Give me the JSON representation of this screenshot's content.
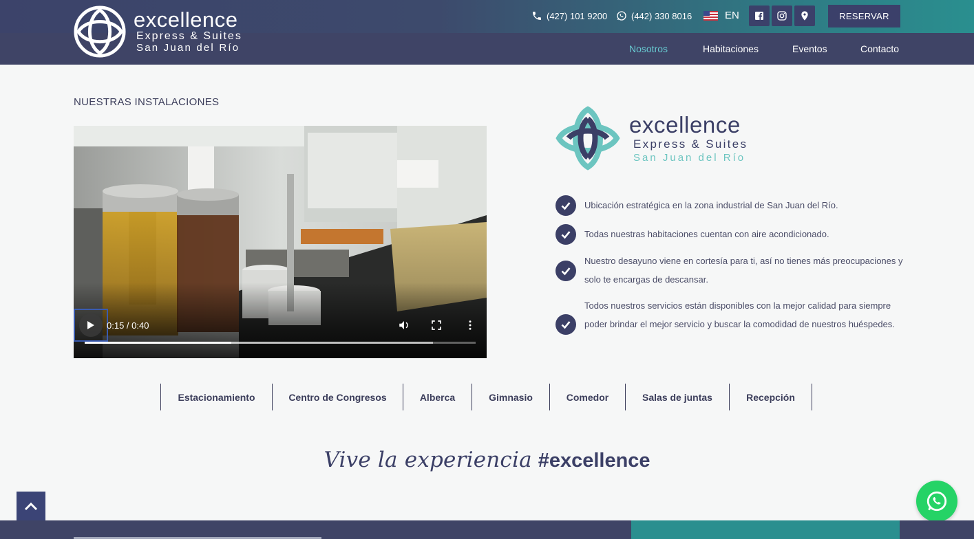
{
  "header": {
    "brand": {
      "word": "excellence",
      "sub1": "Express & Suites",
      "sub2": "San Juan del Río"
    },
    "phone1": {
      "icon": "phone-icon",
      "text": "(427) 101 9200"
    },
    "phone2": {
      "icon": "whatsapp-icon",
      "text": "(442) 330 8016"
    },
    "language": {
      "flag": "us-flag-icon",
      "label": "EN"
    },
    "social": [
      "facebook-icon",
      "instagram-icon",
      "location-pin-icon"
    ],
    "reserve_label": "RESERVAR",
    "nav": [
      {
        "label": "Nosotros",
        "active": true
      },
      {
        "label": "Habitaciones",
        "active": false
      },
      {
        "label": "Eventos",
        "active": false
      },
      {
        "label": "Contacto",
        "active": false
      }
    ]
  },
  "main": {
    "section_title": "NUESTRAS INSTALACIONES",
    "video": {
      "time": "0:15 / 0:40",
      "played": 0.375,
      "buffered": 0.89
    },
    "brand": {
      "word": "excellence",
      "sub1": "Express & Suites",
      "sub2": "San Juan del Río"
    },
    "features": [
      "Ubicación estratégica en la zona industrial de San Juan del Río.",
      "Todas nuestras habitaciones cuentan con aire acondicionado.",
      "Nuestro desayuno viene en cortesía para ti, así no tienes más preocupaciones y solo te encargas de descansar.",
      "Todos nuestros servicios están disponibles con la mejor calidad para siempre poder brindar el mejor servicio y buscar la comodidad de nuestros huéspedes."
    ],
    "tabs": [
      "Estacionamiento",
      "Centro de Congresos",
      "Alberca",
      "Gimnasio",
      "Comedor",
      "Salas de juntas",
      "Recepción"
    ],
    "tagline_script": "Vive la experiencia",
    "tagline_bold": "#excellence"
  },
  "colors": {
    "navy": "#3f4466",
    "teal": "#2a8f8f",
    "accent_nav": "#67c9d0",
    "whatsapp": "#25d366"
  }
}
